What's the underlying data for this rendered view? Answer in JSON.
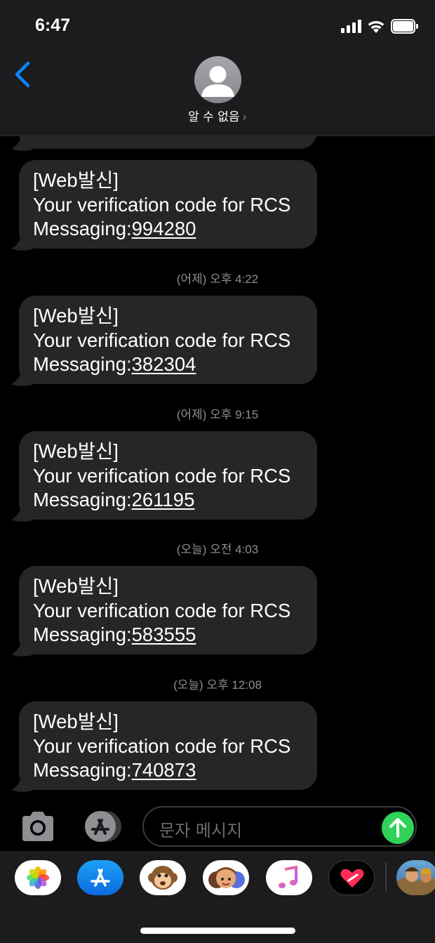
{
  "status_bar": {
    "time": "6:47"
  },
  "header": {
    "contact_name": "알 수 없음",
    "chevron": "›",
    "avatar_icon": "person-silhouette-icon"
  },
  "messages": [
    {
      "tag": "[Web발신]",
      "text": "Your verification code for RCS",
      "prefix": "Messaging:",
      "code": "994280"
    },
    {
      "tag": "[Web발신]",
      "text": "Your verification code for RCS",
      "prefix": "Messaging:",
      "code": "382304"
    },
    {
      "tag": "[Web발신]",
      "text": "Your verification code for RCS",
      "prefix": "Messaging:",
      "code": "261195"
    },
    {
      "tag": "[Web발신]",
      "text": "Your verification code for RCS",
      "prefix": "Messaging:",
      "code": "583555"
    },
    {
      "tag": "[Web발신]",
      "text": "Your verification code for RCS",
      "prefix": "Messaging:",
      "code": "740873"
    }
  ],
  "timestamps": [
    "(어제) 오후 4:22",
    "(어제) 오후 9:15",
    "(오늘) 오전 4:03",
    "(오늘) 오후 12:08"
  ],
  "input_bar": {
    "placeholder": "문자 메시지"
  },
  "app_drawer": {
    "apps": [
      "photos-icon",
      "app-store-icon",
      "animoji-icon",
      "memoji-icon",
      "music-icon",
      "digital-touch-icon",
      "game-app-icon"
    ]
  },
  "colors": {
    "bubble": "#262629",
    "accent": "#0a84ff",
    "send": "#30d158",
    "header": "#1c1c1e",
    "timestamp": "#8e8e93"
  }
}
